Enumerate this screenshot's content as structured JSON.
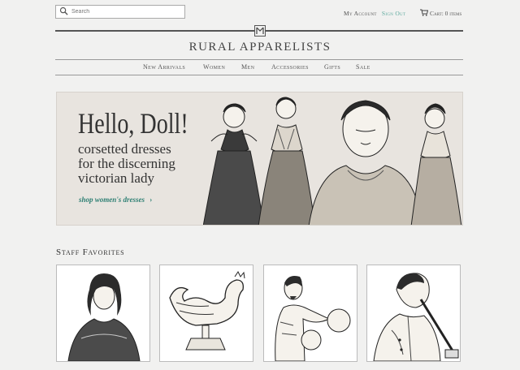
{
  "search": {
    "placeholder": "Search"
  },
  "header": {
    "my_account": "My Account",
    "sign_out": "Sign Out",
    "cart": "Cart: 0 items"
  },
  "brand": {
    "name": "RURAL APPARELISTS"
  },
  "nav": {
    "items": [
      "New Arrivals",
      "Women",
      "Men",
      "Accessories",
      "Gifts",
      "Sale"
    ]
  },
  "hero": {
    "title": "Hello, Doll!",
    "subtitle_lines": [
      "corsetted dresses",
      "for the discerning",
      "victorian lady"
    ],
    "cta": "shop women's dresses"
  },
  "staff_favorites": {
    "title": "Staff Favorites",
    "products": [
      {
        "image": "victorian-woman-portrait-icon"
      },
      {
        "image": "rooster-weathervane-icon"
      },
      {
        "image": "boxer-man-icon"
      },
      {
        "image": "man-with-pipe-icon"
      }
    ]
  },
  "colors": {
    "background": "#f1f1f0",
    "accent": "#2e7f73",
    "link": "#5aa89c",
    "text": "#333333"
  }
}
